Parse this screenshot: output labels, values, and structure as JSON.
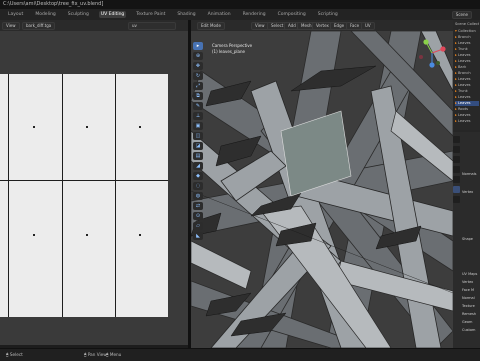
{
  "window": {
    "title": "C:\\Users\\ami\\Desktop\\tree_fix_uv.blend]"
  },
  "menu": {
    "tabs": [
      "Layout",
      "Modeling",
      "Sculpting",
      "UV Editing",
      "Texture Paint",
      "Shading",
      "Animation",
      "Rendering",
      "Compositing",
      "Scripting"
    ],
    "active_tab": "UV Editing",
    "scene": "Scene",
    "options": "Options"
  },
  "uv_editor": {
    "mode": "View",
    "image_name": "bark_diff.tga",
    "uv_map": "uv"
  },
  "viewport": {
    "mode": "Edit Mode",
    "menus": [
      "View",
      "Select",
      "Add",
      "Mesh",
      "Vertex",
      "Edge",
      "Face",
      "UV"
    ],
    "info_line1": "Camera Perspective",
    "info_line2": "(1) leaves_plane"
  },
  "outliner": {
    "header": "Scene Collection",
    "rows": [
      "Collection",
      "Branch",
      "Leaves",
      "Trunk",
      "Leaves",
      "Leaves",
      "Bark",
      "Branch",
      "Leaves",
      "Leaves",
      "Trunk",
      "Leaves",
      "Leaves",
      "Roots",
      "Leaves",
      "Leaves"
    ]
  },
  "properties": {
    "rows": [
      "Normals",
      "Vertex",
      "Shape",
      "UV Maps",
      "Vertex",
      "Face M",
      "Normal",
      "Texture",
      "Remesh",
      "Geom",
      "Custom"
    ]
  },
  "statusbar": {
    "select": "Select",
    "pan": "Pan View",
    "menu": "Menu"
  },
  "colors": {
    "accent": "#4772b3",
    "outliner_icon": "#ff8c1a"
  }
}
